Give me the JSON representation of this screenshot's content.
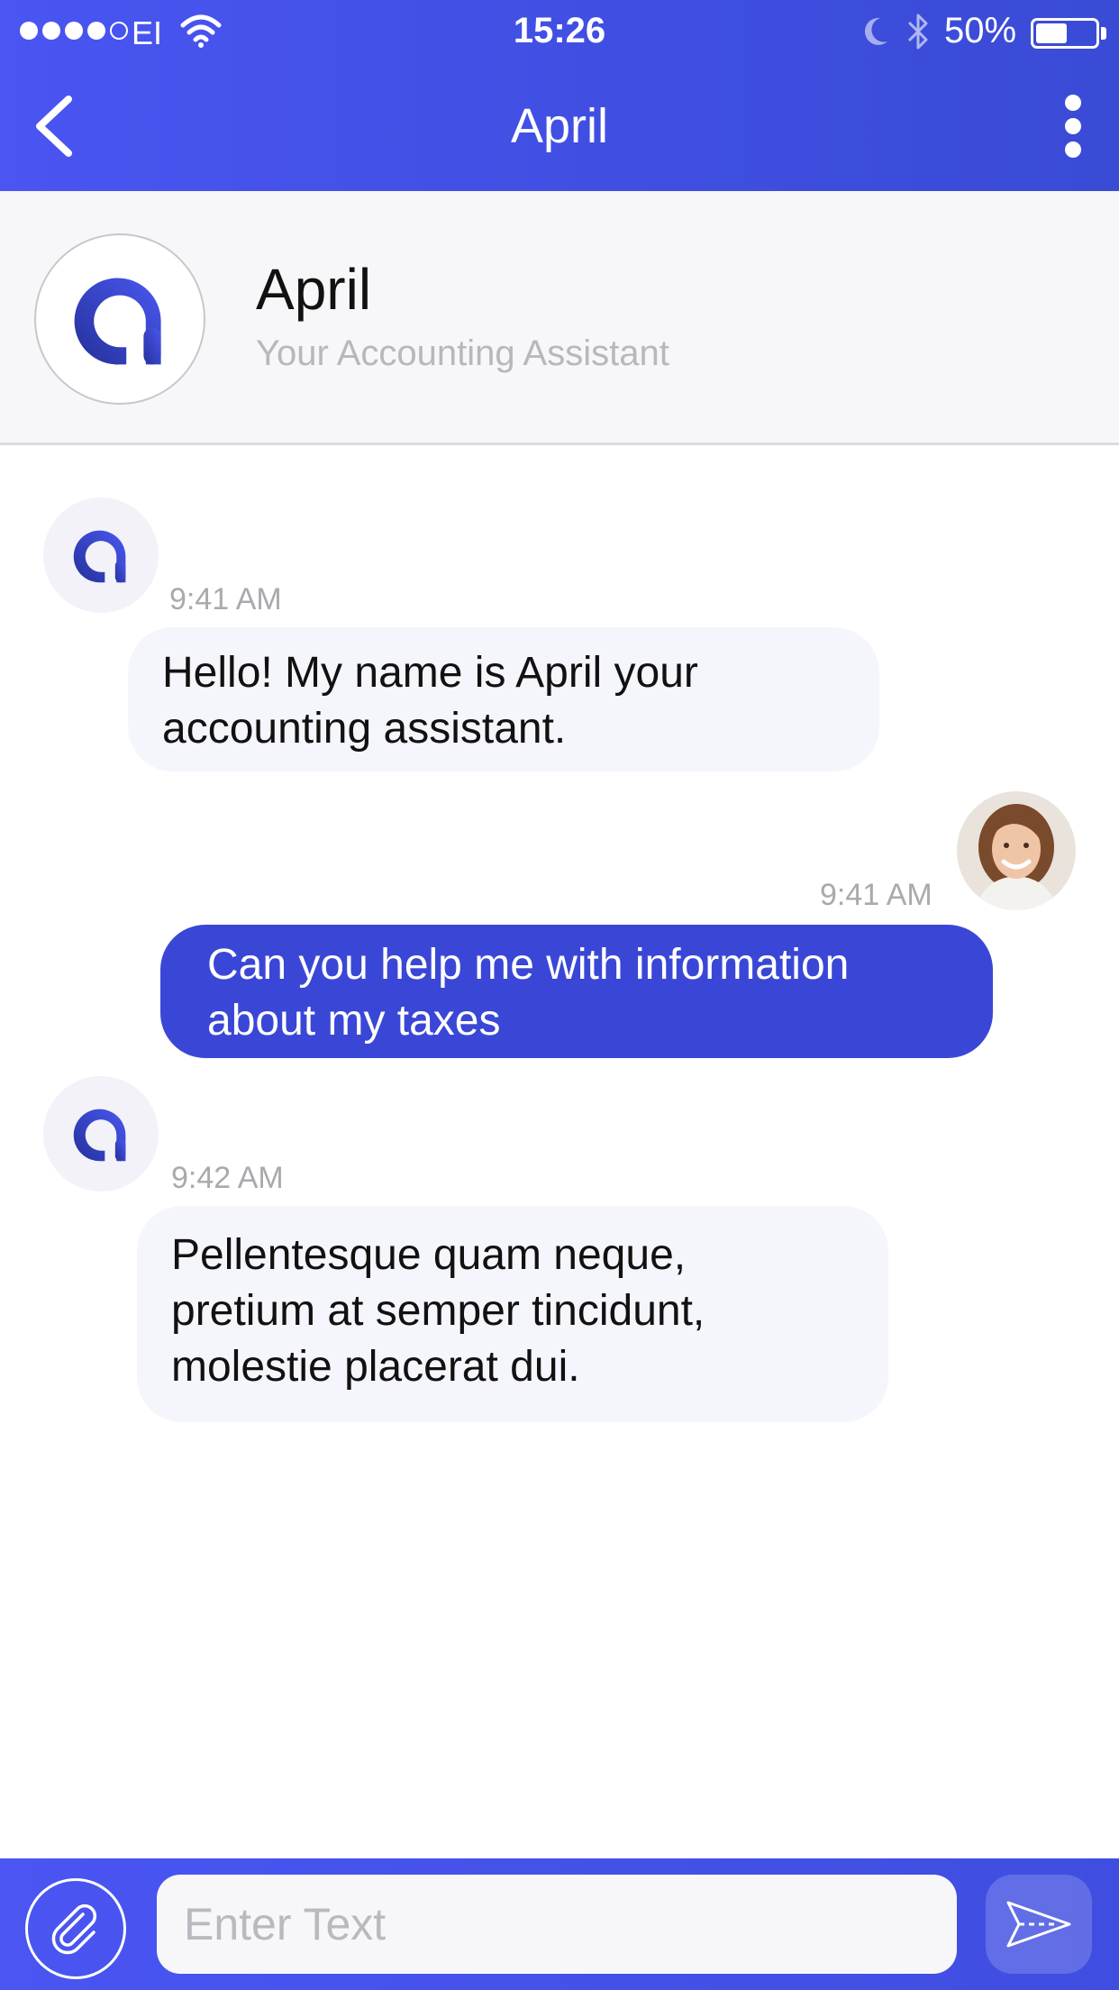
{
  "status_bar": {
    "carrier": "EI",
    "time": "15:26",
    "battery_percent": "50%",
    "battery_level": 0.5,
    "signal_bars_filled": 4,
    "signal_bars_total": 5
  },
  "nav": {
    "title": "April",
    "back_icon": "chevron-left-icon",
    "more_icon": "vertical-ellipsis-icon"
  },
  "profile": {
    "name": "April",
    "subtitle": "Your Accounting Assistant"
  },
  "messages": [
    {
      "sender": "bot",
      "time": "9:41 AM",
      "lines": [
        "Hello! My name is April your",
        "accounting assistant."
      ]
    },
    {
      "sender": "user",
      "time": "9:41 AM",
      "lines": [
        "Can you help me with information",
        "about my taxes"
      ]
    },
    {
      "sender": "bot",
      "time": "9:42 AM",
      "lines": [
        "Pellentesque quam neque,",
        "pretium at semper tincidunt,",
        "molestie placerat dui."
      ]
    }
  ],
  "input": {
    "placeholder": "Enter Text",
    "attach_icon": "paperclip-icon",
    "send_icon": "send-icon"
  },
  "colors": {
    "header": "#4a55f2",
    "outgoing_bubble": "#3a47d6",
    "incoming_bubble": "#f5f5fc",
    "logo_blue": "#3446d8"
  }
}
